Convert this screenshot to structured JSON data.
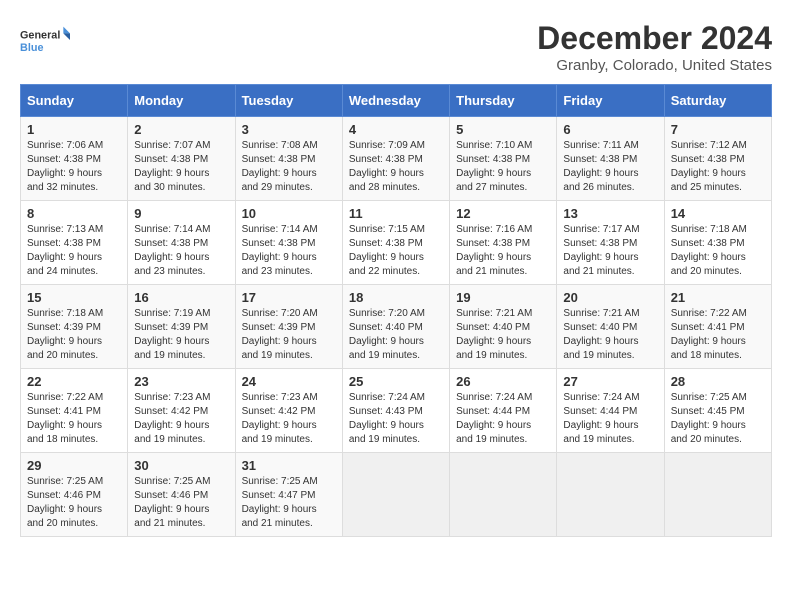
{
  "header": {
    "logo_line1": "General",
    "logo_line2": "Blue",
    "month": "December 2024",
    "location": "Granby, Colorado, United States"
  },
  "days_of_week": [
    "Sunday",
    "Monday",
    "Tuesday",
    "Wednesday",
    "Thursday",
    "Friday",
    "Saturday"
  ],
  "weeks": [
    [
      {
        "day": "1",
        "sunrise": "7:06 AM",
        "sunset": "4:38 PM",
        "daylight": "9 hours and 32 minutes."
      },
      {
        "day": "2",
        "sunrise": "7:07 AM",
        "sunset": "4:38 PM",
        "daylight": "9 hours and 30 minutes."
      },
      {
        "day": "3",
        "sunrise": "7:08 AM",
        "sunset": "4:38 PM",
        "daylight": "9 hours and 29 minutes."
      },
      {
        "day": "4",
        "sunrise": "7:09 AM",
        "sunset": "4:38 PM",
        "daylight": "9 hours and 28 minutes."
      },
      {
        "day": "5",
        "sunrise": "7:10 AM",
        "sunset": "4:38 PM",
        "daylight": "9 hours and 27 minutes."
      },
      {
        "day": "6",
        "sunrise": "7:11 AM",
        "sunset": "4:38 PM",
        "daylight": "9 hours and 26 minutes."
      },
      {
        "day": "7",
        "sunrise": "7:12 AM",
        "sunset": "4:38 PM",
        "daylight": "9 hours and 25 minutes."
      }
    ],
    [
      {
        "day": "8",
        "sunrise": "7:13 AM",
        "sunset": "4:38 PM",
        "daylight": "9 hours and 24 minutes."
      },
      {
        "day": "9",
        "sunrise": "7:14 AM",
        "sunset": "4:38 PM",
        "daylight": "9 hours and 23 minutes."
      },
      {
        "day": "10",
        "sunrise": "7:14 AM",
        "sunset": "4:38 PM",
        "daylight": "9 hours and 23 minutes."
      },
      {
        "day": "11",
        "sunrise": "7:15 AM",
        "sunset": "4:38 PM",
        "daylight": "9 hours and 22 minutes."
      },
      {
        "day": "12",
        "sunrise": "7:16 AM",
        "sunset": "4:38 PM",
        "daylight": "9 hours and 21 minutes."
      },
      {
        "day": "13",
        "sunrise": "7:17 AM",
        "sunset": "4:38 PM",
        "daylight": "9 hours and 21 minutes."
      },
      {
        "day": "14",
        "sunrise": "7:18 AM",
        "sunset": "4:38 PM",
        "daylight": "9 hours and 20 minutes."
      }
    ],
    [
      {
        "day": "15",
        "sunrise": "7:18 AM",
        "sunset": "4:39 PM",
        "daylight": "9 hours and 20 minutes."
      },
      {
        "day": "16",
        "sunrise": "7:19 AM",
        "sunset": "4:39 PM",
        "daylight": "9 hours and 19 minutes."
      },
      {
        "day": "17",
        "sunrise": "7:20 AM",
        "sunset": "4:39 PM",
        "daylight": "9 hours and 19 minutes."
      },
      {
        "day": "18",
        "sunrise": "7:20 AM",
        "sunset": "4:40 PM",
        "daylight": "9 hours and 19 minutes."
      },
      {
        "day": "19",
        "sunrise": "7:21 AM",
        "sunset": "4:40 PM",
        "daylight": "9 hours and 19 minutes."
      },
      {
        "day": "20",
        "sunrise": "7:21 AM",
        "sunset": "4:40 PM",
        "daylight": "9 hours and 19 minutes."
      },
      {
        "day": "21",
        "sunrise": "7:22 AM",
        "sunset": "4:41 PM",
        "daylight": "9 hours and 18 minutes."
      }
    ],
    [
      {
        "day": "22",
        "sunrise": "7:22 AM",
        "sunset": "4:41 PM",
        "daylight": "9 hours and 18 minutes."
      },
      {
        "day": "23",
        "sunrise": "7:23 AM",
        "sunset": "4:42 PM",
        "daylight": "9 hours and 19 minutes."
      },
      {
        "day": "24",
        "sunrise": "7:23 AM",
        "sunset": "4:42 PM",
        "daylight": "9 hours and 19 minutes."
      },
      {
        "day": "25",
        "sunrise": "7:24 AM",
        "sunset": "4:43 PM",
        "daylight": "9 hours and 19 minutes."
      },
      {
        "day": "26",
        "sunrise": "7:24 AM",
        "sunset": "4:44 PM",
        "daylight": "9 hours and 19 minutes."
      },
      {
        "day": "27",
        "sunrise": "7:24 AM",
        "sunset": "4:44 PM",
        "daylight": "9 hours and 19 minutes."
      },
      {
        "day": "28",
        "sunrise": "7:25 AM",
        "sunset": "4:45 PM",
        "daylight": "9 hours and 20 minutes."
      }
    ],
    [
      {
        "day": "29",
        "sunrise": "7:25 AM",
        "sunset": "4:46 PM",
        "daylight": "9 hours and 20 minutes."
      },
      {
        "day": "30",
        "sunrise": "7:25 AM",
        "sunset": "4:46 PM",
        "daylight": "9 hours and 21 minutes."
      },
      {
        "day": "31",
        "sunrise": "7:25 AM",
        "sunset": "4:47 PM",
        "daylight": "9 hours and 21 minutes."
      },
      null,
      null,
      null,
      null
    ]
  ]
}
